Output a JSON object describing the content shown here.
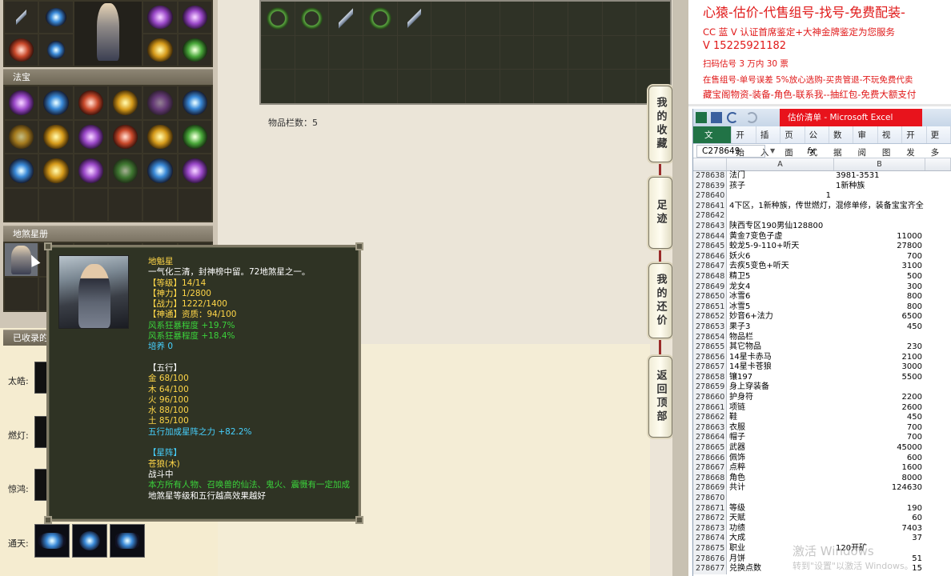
{
  "game": {
    "section_fabao": "法宝",
    "section_disha": "地煞星册",
    "section_collected": "已收录的",
    "storage_count_label": "物品栏数：5",
    "collected_rows": [
      {
        "label": "太皓:"
      },
      {
        "label": "燃灯:"
      },
      {
        "label": "惊鸿:"
      },
      {
        "label": "通天:"
      }
    ],
    "side_buttons": [
      "我的收藏",
      "足迹",
      "我的还价",
      "返回顶部"
    ]
  },
  "tooltip": {
    "name": "地魁星",
    "desc": "一气化三清，封神榜中留。72地煞星之一。",
    "level": "【等级】14/14",
    "shenli": "【神力】1/2800",
    "zhanli": "【战力】1222/1400",
    "shentong": "【神通】资质：94/100",
    "bonus1": "风系狂暴程度 +19.7%",
    "bonus2": "风系狂暴程度 +18.4%",
    "peiyang": "培养 0",
    "wuxing_title": "【五行】",
    "wx_jin": "金 68/100",
    "wx_mu": "木 64/100",
    "wx_huo": "火 96/100",
    "wx_shui": "水 88/100",
    "wx_tu": "土 85/100",
    "wx_bonus": "五行加成星阵之力 +82.2%",
    "xingzhen_title": "【星阵】",
    "xingzhen_name": "苍狼(木)",
    "status": "战斗中",
    "effect": "本方所有人物、召唤兽的仙法、鬼火、震慑有一定加成",
    "note": "地煞星等级和五行越高效果越好"
  },
  "web": {
    "line1": "心猿-估价-代售组号-找号-免费配装-",
    "line2": "CC 蓝 V 认证首席鉴定+大神金牌鉴定为您服务",
    "line3": "V 15225921182",
    "line4": "扫码估号 3 万内 30 票",
    "line5": "在售组号-单号误差 5%放心选购-买贵管退-不玩免费代卖",
    "line6": "藏宝阁物资-装备-角色-联系我--抽红包-免费大额支付"
  },
  "excel": {
    "window_title": "估价清单 - Microsoft Excel",
    "tabs": [
      "文件",
      "开始",
      "插入",
      "页面",
      "公式",
      "数据",
      "审阅",
      "视图",
      "开发",
      "更多"
    ],
    "namebox": "C278649",
    "fx": "fx",
    "col_a": "A",
    "col_b": "B",
    "rows": [
      {
        "n": "278638",
        "a": "法门",
        "b": "3981-3531",
        "bl": true
      },
      {
        "n": "278639",
        "a": "孩子",
        "b": "1新种族",
        "bl": true
      },
      {
        "n": "278640",
        "a": "",
        "b": "1",
        "bl": false,
        "a_right": "1"
      },
      {
        "n": "278641",
        "a": "4下区，1新种族，传世燃灯，混修单修，装备宝宝齐全",
        "b": "",
        "bl": false
      },
      {
        "n": "278642",
        "a": "",
        "b": "",
        "bl": false
      },
      {
        "n": "278643",
        "a": "陕西专区190男仙128800",
        "b": "",
        "bl": false
      },
      {
        "n": "278644",
        "a": "黄金7变色子虚",
        "b": "11000",
        "bl": false
      },
      {
        "n": "278645",
        "a": "蛟龙5-9-110+听天",
        "b": "27800",
        "bl": false
      },
      {
        "n": "278646",
        "a": "妖火6",
        "b": "700",
        "bl": false
      },
      {
        "n": "278647",
        "a": "去疾5变色+听天",
        "b": "3100",
        "bl": false
      },
      {
        "n": "278648",
        "a": "精卫5",
        "b": "500",
        "bl": false
      },
      {
        "n": "278649",
        "a": "龙女4",
        "b": "300",
        "bl": false
      },
      {
        "n": "278650",
        "a": "冰雪6",
        "b": "800",
        "bl": false
      },
      {
        "n": "278651",
        "a": "冰雪5",
        "b": "800",
        "bl": false
      },
      {
        "n": "278652",
        "a": "妙音6+法力",
        "b": "6500",
        "bl": false
      },
      {
        "n": "278653",
        "a": "果子3",
        "b": "450",
        "bl": false
      },
      {
        "n": "278654",
        "a": "物品栏",
        "b": "",
        "bl": false
      },
      {
        "n": "278655",
        "a": "其它物品",
        "b": "230",
        "bl": false
      },
      {
        "n": "278656",
        "a": "14星卡赤马",
        "b": "2100",
        "bl": false
      },
      {
        "n": "278657",
        "a": "14星卡苍狼",
        "b": "3000",
        "bl": false
      },
      {
        "n": "278658",
        "a": "镶197",
        "b": "5500",
        "bl": false
      },
      {
        "n": "278659",
        "a": "身上穿装备",
        "b": "",
        "bl": false
      },
      {
        "n": "278660",
        "a": "护身符",
        "b": "2200",
        "bl": false
      },
      {
        "n": "278661",
        "a": "项链",
        "b": "2600",
        "bl": false
      },
      {
        "n": "278662",
        "a": "鞋",
        "b": "450",
        "bl": false
      },
      {
        "n": "278663",
        "a": "衣服",
        "b": "700",
        "bl": false
      },
      {
        "n": "278664",
        "a": "帽子",
        "b": "700",
        "bl": false
      },
      {
        "n": "278665",
        "a": "武器",
        "b": "45000",
        "bl": false
      },
      {
        "n": "278666",
        "a": "佩饰",
        "b": "600",
        "bl": false
      },
      {
        "n": "278667",
        "a": "点粹",
        "b": "1600",
        "bl": false
      },
      {
        "n": "278668",
        "a": "角色",
        "b": "8000",
        "bl": false
      },
      {
        "n": "278669",
        "a": "共计",
        "b": "124630",
        "bl": false
      },
      {
        "n": "278670",
        "a": "",
        "b": "",
        "bl": false
      },
      {
        "n": "278671",
        "a": "等级",
        "b": "190",
        "bl": false
      },
      {
        "n": "278672",
        "a": "天赋",
        "b": "60",
        "bl": false
      },
      {
        "n": "278673",
        "a": "功绩",
        "b": "7403",
        "bl": false
      },
      {
        "n": "278674",
        "a": "大成",
        "b": "37",
        "bl": false
      },
      {
        "n": "278675",
        "a": "职业",
        "b": "120开矿",
        "bl": true
      },
      {
        "n": "278676",
        "a": "月饼",
        "b": "51",
        "bl": false
      },
      {
        "n": "278677",
        "a": "兑换点数",
        "b": "15",
        "bl": false
      }
    ]
  },
  "watermark": {
    "line1": "激活 Windows",
    "line2": "转到\"设置\"以激活 Windows。"
  }
}
